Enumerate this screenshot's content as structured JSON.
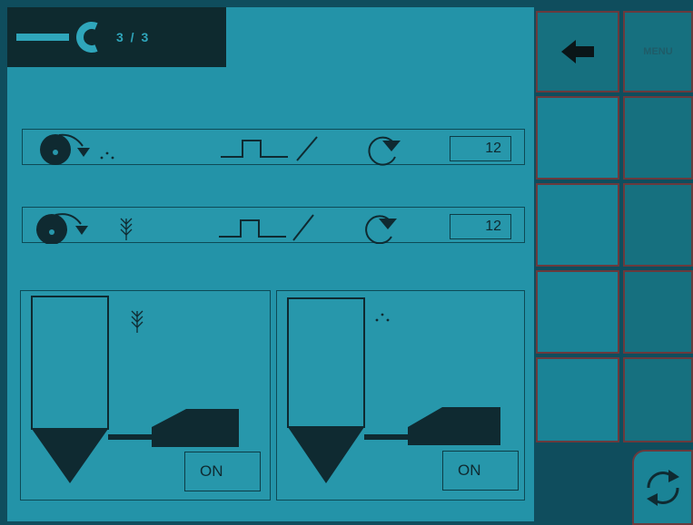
{
  "header": {
    "page_indicator": "3 / 3",
    "icon": "wrench-icon"
  },
  "rows": [
    {
      "value": "12",
      "material_icon": "dots-icon"
    },
    {
      "value": "12",
      "material_icon": "seed-icon"
    }
  ],
  "panels": [
    {
      "status": "ON",
      "material_icon": "seed-icon"
    },
    {
      "status": "ON",
      "material_icon": "dots-icon"
    }
  ],
  "sidebar": {
    "back_icon": "arrow-left-icon",
    "menu_label": "MENU",
    "refresh_icon": "refresh-icon"
  },
  "colors": {
    "screen": "#2393a8",
    "dark": "#0f2a31",
    "frame": "#0f4d5d"
  }
}
